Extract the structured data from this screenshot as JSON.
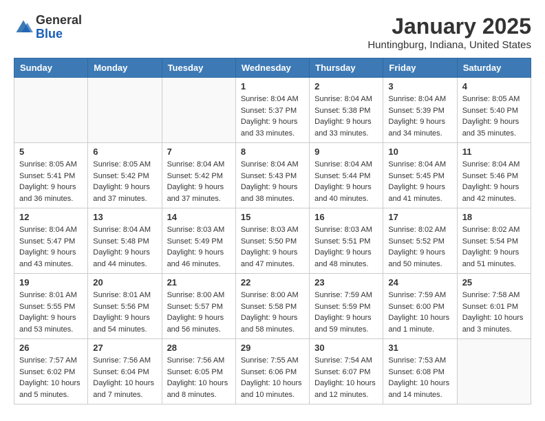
{
  "header": {
    "logo": {
      "general": "General",
      "blue": "Blue"
    },
    "title": "January 2025",
    "location": "Huntingburg, Indiana, United States"
  },
  "calendar": {
    "days_of_week": [
      "Sunday",
      "Monday",
      "Tuesday",
      "Wednesday",
      "Thursday",
      "Friday",
      "Saturday"
    ],
    "weeks": [
      [
        {
          "day": "",
          "info": ""
        },
        {
          "day": "",
          "info": ""
        },
        {
          "day": "",
          "info": ""
        },
        {
          "day": "1",
          "info": "Sunrise: 8:04 AM\nSunset: 5:37 PM\nDaylight: 9 hours and 33 minutes."
        },
        {
          "day": "2",
          "info": "Sunrise: 8:04 AM\nSunset: 5:38 PM\nDaylight: 9 hours and 33 minutes."
        },
        {
          "day": "3",
          "info": "Sunrise: 8:04 AM\nSunset: 5:39 PM\nDaylight: 9 hours and 34 minutes."
        },
        {
          "day": "4",
          "info": "Sunrise: 8:05 AM\nSunset: 5:40 PM\nDaylight: 9 hours and 35 minutes."
        }
      ],
      [
        {
          "day": "5",
          "info": "Sunrise: 8:05 AM\nSunset: 5:41 PM\nDaylight: 9 hours and 36 minutes."
        },
        {
          "day": "6",
          "info": "Sunrise: 8:05 AM\nSunset: 5:42 PM\nDaylight: 9 hours and 37 minutes."
        },
        {
          "day": "7",
          "info": "Sunrise: 8:04 AM\nSunset: 5:42 PM\nDaylight: 9 hours and 37 minutes."
        },
        {
          "day": "8",
          "info": "Sunrise: 8:04 AM\nSunset: 5:43 PM\nDaylight: 9 hours and 38 minutes."
        },
        {
          "day": "9",
          "info": "Sunrise: 8:04 AM\nSunset: 5:44 PM\nDaylight: 9 hours and 40 minutes."
        },
        {
          "day": "10",
          "info": "Sunrise: 8:04 AM\nSunset: 5:45 PM\nDaylight: 9 hours and 41 minutes."
        },
        {
          "day": "11",
          "info": "Sunrise: 8:04 AM\nSunset: 5:46 PM\nDaylight: 9 hours and 42 minutes."
        }
      ],
      [
        {
          "day": "12",
          "info": "Sunrise: 8:04 AM\nSunset: 5:47 PM\nDaylight: 9 hours and 43 minutes."
        },
        {
          "day": "13",
          "info": "Sunrise: 8:04 AM\nSunset: 5:48 PM\nDaylight: 9 hours and 44 minutes."
        },
        {
          "day": "14",
          "info": "Sunrise: 8:03 AM\nSunset: 5:49 PM\nDaylight: 9 hours and 46 minutes."
        },
        {
          "day": "15",
          "info": "Sunrise: 8:03 AM\nSunset: 5:50 PM\nDaylight: 9 hours and 47 minutes."
        },
        {
          "day": "16",
          "info": "Sunrise: 8:03 AM\nSunset: 5:51 PM\nDaylight: 9 hours and 48 minutes."
        },
        {
          "day": "17",
          "info": "Sunrise: 8:02 AM\nSunset: 5:52 PM\nDaylight: 9 hours and 50 minutes."
        },
        {
          "day": "18",
          "info": "Sunrise: 8:02 AM\nSunset: 5:54 PM\nDaylight: 9 hours and 51 minutes."
        }
      ],
      [
        {
          "day": "19",
          "info": "Sunrise: 8:01 AM\nSunset: 5:55 PM\nDaylight: 9 hours and 53 minutes."
        },
        {
          "day": "20",
          "info": "Sunrise: 8:01 AM\nSunset: 5:56 PM\nDaylight: 9 hours and 54 minutes."
        },
        {
          "day": "21",
          "info": "Sunrise: 8:00 AM\nSunset: 5:57 PM\nDaylight: 9 hours and 56 minutes."
        },
        {
          "day": "22",
          "info": "Sunrise: 8:00 AM\nSunset: 5:58 PM\nDaylight: 9 hours and 58 minutes."
        },
        {
          "day": "23",
          "info": "Sunrise: 7:59 AM\nSunset: 5:59 PM\nDaylight: 9 hours and 59 minutes."
        },
        {
          "day": "24",
          "info": "Sunrise: 7:59 AM\nSunset: 6:00 PM\nDaylight: 10 hours and 1 minute."
        },
        {
          "day": "25",
          "info": "Sunrise: 7:58 AM\nSunset: 6:01 PM\nDaylight: 10 hours and 3 minutes."
        }
      ],
      [
        {
          "day": "26",
          "info": "Sunrise: 7:57 AM\nSunset: 6:02 PM\nDaylight: 10 hours and 5 minutes."
        },
        {
          "day": "27",
          "info": "Sunrise: 7:56 AM\nSunset: 6:04 PM\nDaylight: 10 hours and 7 minutes."
        },
        {
          "day": "28",
          "info": "Sunrise: 7:56 AM\nSunset: 6:05 PM\nDaylight: 10 hours and 8 minutes."
        },
        {
          "day": "29",
          "info": "Sunrise: 7:55 AM\nSunset: 6:06 PM\nDaylight: 10 hours and 10 minutes."
        },
        {
          "day": "30",
          "info": "Sunrise: 7:54 AM\nSunset: 6:07 PM\nDaylight: 10 hours and 12 minutes."
        },
        {
          "day": "31",
          "info": "Sunrise: 7:53 AM\nSunset: 6:08 PM\nDaylight: 10 hours and 14 minutes."
        },
        {
          "day": "",
          "info": ""
        }
      ]
    ]
  }
}
